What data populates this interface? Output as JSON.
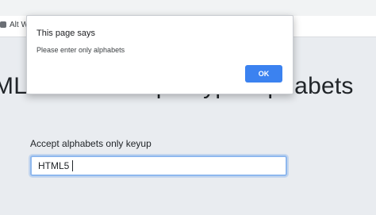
{
  "browser": {
    "tab_label": "Alt W"
  },
  "dialog": {
    "title": "This page says",
    "message": "Please enter only alphabets",
    "ok_label": "OK",
    "accent_color": "#3b82f0"
  },
  "page": {
    "heading": "ML5 validate input type alphabets",
    "field_label": "Accept alphabets only keyup",
    "input_value": "HTML5"
  }
}
